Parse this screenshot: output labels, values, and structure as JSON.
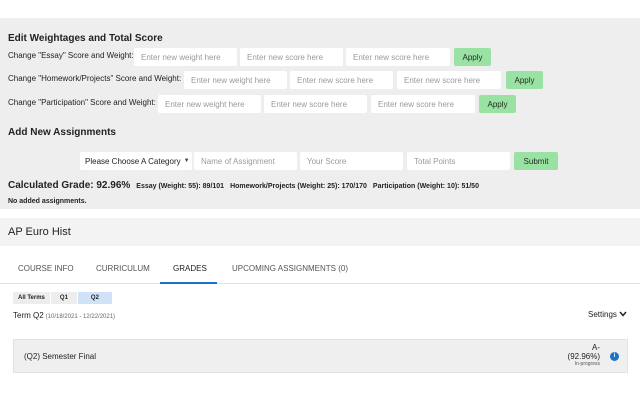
{
  "weights": {
    "title": "Edit Weightages and Total Score",
    "weight_placeholder": "Enter new weight here",
    "score_placeholder": "Enter new score here",
    "apply_label": "Apply",
    "rows": [
      {
        "label": "Change \"Essay\" Score and Weight:"
      },
      {
        "label": "Change \"Homework/Projects\" Score and Weight:"
      },
      {
        "label": "Change \"Participation\" Score and Weight:"
      }
    ]
  },
  "assignments": {
    "title": "Add New Assignments",
    "category_default": "Please Choose A Category",
    "name_placeholder": "Name of Assignment",
    "score_placeholder": "Your Score",
    "total_placeholder": "Total Points",
    "submit_label": "Submit"
  },
  "summary": {
    "calculated": "Calculated Grade: 92.96%",
    "essay": "Essay (Weight: 55): 89/101",
    "homework": "Homework/Projects (Weight: 25): 170/170",
    "participation": "Participation (Weight: 10): 51/50",
    "no_added": "No added assignments."
  },
  "course": {
    "title": "AP Euro Hist"
  },
  "tabs": [
    {
      "label": "COURSE INFO"
    },
    {
      "label": "CURRICULUM"
    },
    {
      "label": "GRADES"
    },
    {
      "label": "UPCOMING ASSIGNMENTS (0)"
    }
  ],
  "terms": [
    "All Terms",
    "Q1",
    "Q2"
  ],
  "term_info": {
    "label": "Term Q2",
    "dates": "(10/18/2021 - 12/22/2021)"
  },
  "settings_label": "Settings",
  "final": {
    "label": "(Q2) Semester Final",
    "letter": "A-",
    "percent": "(92.96%)",
    "status": "In-progress"
  },
  "colors": {
    "accent": "#1a73c9",
    "apply_green": "#9ae2a3",
    "panel_bg": "#eeeeee"
  }
}
